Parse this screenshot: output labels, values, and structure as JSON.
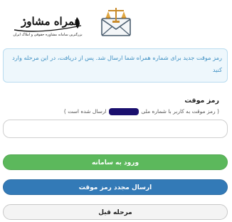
{
  "header": {
    "logo_text": "همراه مشاور",
    "logo_tagline": "بزرگترین سامانه مشاوره حقوقی و املاک ایران"
  },
  "info": {
    "message": "رمز موقت جدید برای شماره همراه شما ارسال شد. پس از دریافت، در این مرحله وارد کنید"
  },
  "form": {
    "code_label": "رمز موقت",
    "hint_before": "( رمز موقت به کاربر با شماره ملی",
    "hint_after": "ارسال شده است )",
    "code_value": ""
  },
  "buttons": {
    "login": "ورود به سامانه",
    "resend": "ارسال مجدد رمز موقت",
    "previous": "مرحله قبل"
  },
  "colors": {
    "info_text": "#3d8fc2",
    "login_green": "#5cb85c",
    "resend_blue": "#337ab7"
  }
}
